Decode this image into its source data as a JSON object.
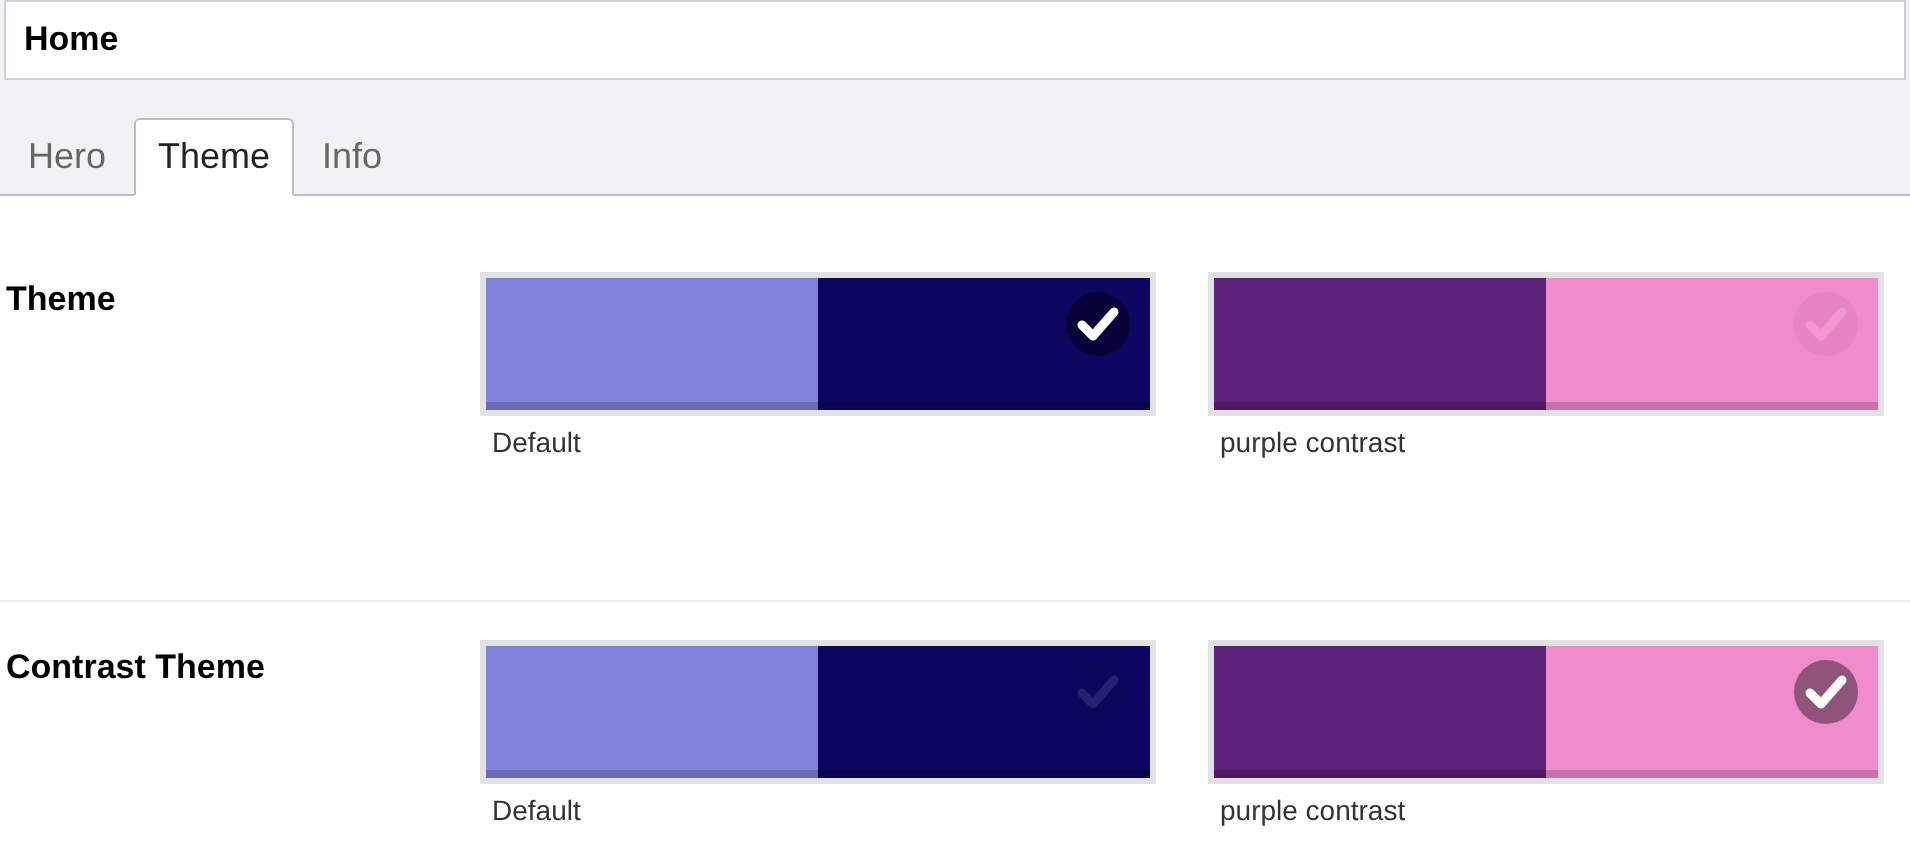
{
  "header": {
    "title": "Home"
  },
  "tabs": [
    {
      "label": "Hero",
      "selected": false
    },
    {
      "label": "Theme",
      "selected": true
    },
    {
      "label": "Info",
      "selected": false
    }
  ],
  "sections": [
    {
      "label": "Theme",
      "options": [
        {
          "name": "Default",
          "selected": true,
          "swatches": [
            {
              "color": "#8183dc"
            },
            {
              "color": "#0d0660"
            }
          ]
        },
        {
          "name": "purple contrast",
          "selected": false,
          "swatches": [
            {
              "color": "#5e227c"
            },
            {
              "color": "#f08bcc"
            }
          ]
        }
      ]
    },
    {
      "label": "Contrast Theme",
      "options": [
        {
          "name": "Default",
          "selected": false,
          "swatches": [
            {
              "color": "#8183dc"
            },
            {
              "color": "#0d0660"
            }
          ]
        },
        {
          "name": "purple contrast",
          "selected": true,
          "swatches": [
            {
              "color": "#5e227c"
            },
            {
              "color": "#f08bcc"
            }
          ]
        }
      ]
    }
  ]
}
